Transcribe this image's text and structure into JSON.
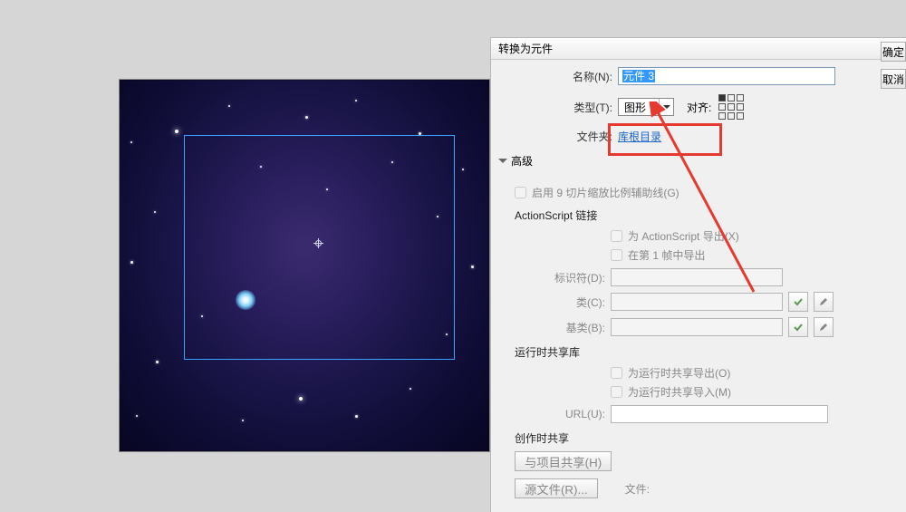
{
  "dialog": {
    "title": "转换为元件",
    "name_label": "名称(N):",
    "name_value": "元件 3",
    "type_label": "类型(T):",
    "type_value": "图形",
    "align_label": "对齐:",
    "folder_label": "文件夹:",
    "folder_value": "库根目录",
    "ok_label": "确定",
    "cancel_label": "取消"
  },
  "advanced": {
    "toggle_label": "高级",
    "slice_label": "启用 9 切片缩放比例辅助线(G)",
    "as_section": "ActionScript 链接",
    "export_as_label": "为 ActionScript 导出(X)",
    "export_frame1_label": "在第 1 帧中导出",
    "identifier_label": "标识符(D):",
    "class_label": "类(C):",
    "baseclass_label": "基类(B):"
  },
  "runtime": {
    "section": "运行时共享库",
    "export_label": "为运行时共享导出(O)",
    "import_label": "为运行时共享导入(M)",
    "url_label": "URL(U):"
  },
  "authortime": {
    "section": "创作时共享",
    "share_button": "与项目共享(H)",
    "srcfile_label": "源文件(R)...",
    "file_label": "文件:"
  }
}
